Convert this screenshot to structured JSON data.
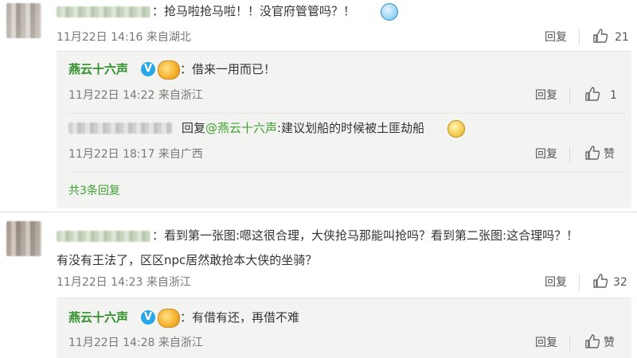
{
  "comments": [
    {
      "text": "：抢马啦抢马啦！！没官府管管吗？！",
      "time": "11月22日 14:16 来自湖北",
      "reply_label": "回复",
      "likes": "21",
      "replies": [
        {
          "author": "燕云十六声",
          "text": "：借来一用而已！",
          "time": "11月22日 14:22 来自浙江",
          "reply_label": "回复",
          "likes": "1"
        },
        {
          "prefix": "回复",
          "mention": "@燕云十六声",
          "text": ":建议划船的时候被土匪劫船",
          "time": "11月22日 18:17 来自广西",
          "reply_label": "回复",
          "likes": "赞"
        }
      ],
      "more_link": "共3条回复"
    },
    {
      "text_line1": "：看到第一张图:嗯这很合理，大侠抢马那能叫抢吗？看到第二张图:这合理吗？！",
      "text_line2": "有没有王法了，区区npc居然敢抢本大侠的坐骑？",
      "time": "11月22日 14:23 来自浙江",
      "reply_label": "回复",
      "likes": "32",
      "replies": [
        {
          "author": "燕云十六声",
          "text": "：有借有还，再借不难",
          "time": "11月22日 14:28 来自浙江",
          "reply_label": "回复",
          "likes": "赞"
        }
      ]
    }
  ],
  "colors": {
    "link_green": "#3f9f2f",
    "verified_blue": "#2aa7e8",
    "reply_bg": "#f3f4f2"
  },
  "icons": [
    "thumb-up-icon",
    "verified-icon",
    "member-badge-icon",
    "emoji-icon"
  ]
}
